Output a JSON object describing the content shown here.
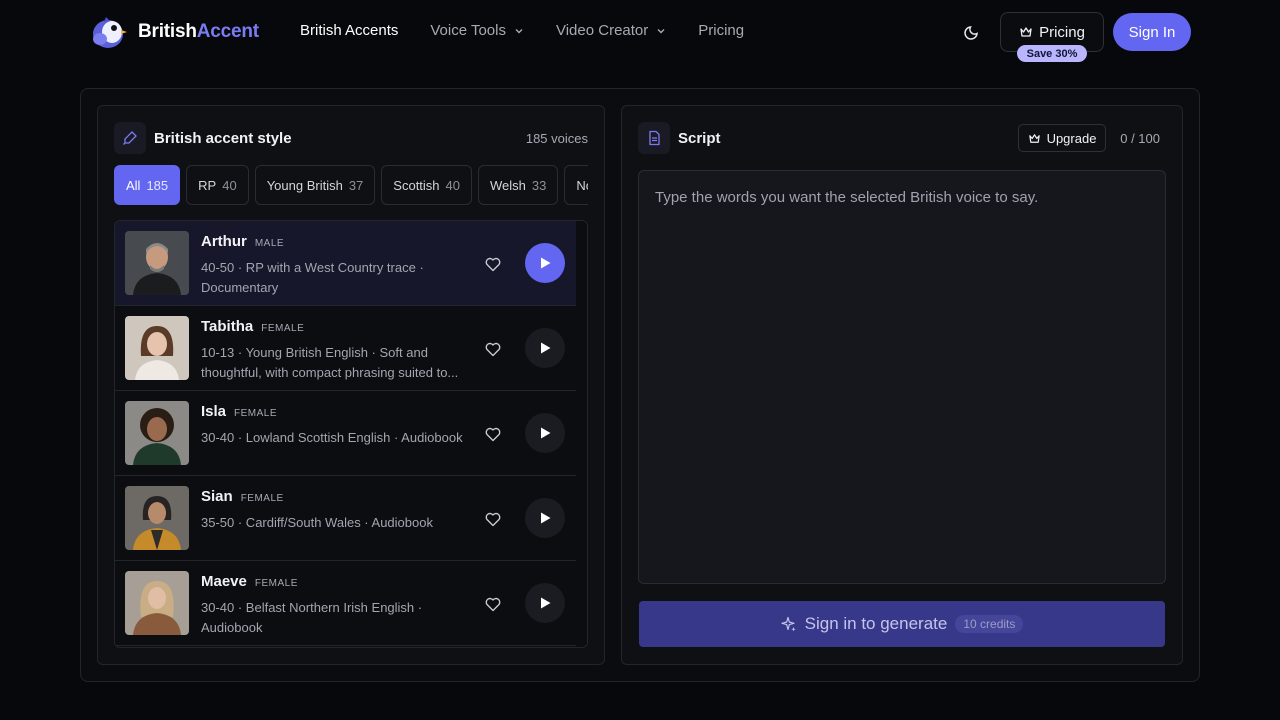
{
  "nav": {
    "brand_part1": "British",
    "brand_part2": "Accent",
    "links": [
      {
        "label": "British Accents"
      },
      {
        "label": "Voice Tools"
      },
      {
        "label": "Video Creator"
      },
      {
        "label": "Pricing"
      }
    ],
    "pricing_button": "Pricing",
    "save_badge": "Save 30%",
    "sign_in": "Sign In"
  },
  "voices_panel": {
    "title": "British accent style",
    "count": "185 voices",
    "filters": [
      {
        "label": "All",
        "count": "185"
      },
      {
        "label": "RP",
        "count": "40"
      },
      {
        "label": "Young British",
        "count": "37"
      },
      {
        "label": "Scottish",
        "count": "40"
      },
      {
        "label": "Welsh",
        "count": "33"
      },
      {
        "label": "Nor",
        "count": ""
      }
    ],
    "voices": [
      {
        "name": "Arthur",
        "gender": "MALE",
        "description": "40-50 · RP with a West Country trace · Documentary"
      },
      {
        "name": "Tabitha",
        "gender": "FEMALE",
        "description": "10-13 · Young British English · Soft and thoughtful, with compact phrasing suited to..."
      },
      {
        "name": "Isla",
        "gender": "FEMALE",
        "description": "30-40 · Lowland Scottish English · Audiobook"
      },
      {
        "name": "Sian",
        "gender": "FEMALE",
        "description": "35-50 · Cardiff/South Wales · Audiobook"
      },
      {
        "name": "Maeve",
        "gender": "FEMALE",
        "description": "30-40 · Belfast Northern Irish English · Audiobook"
      }
    ]
  },
  "script_panel": {
    "title": "Script",
    "upgrade_button": "Upgrade",
    "char_count": "0 / 100",
    "placeholder": "Type the words you want the selected British voice to say.",
    "generate_button": "Sign in to generate",
    "credits": "10 credits"
  },
  "colors": {
    "accent": "#6366f1",
    "background": "#07080b",
    "panel": "#0f1014",
    "badge": "#b9b6ff"
  },
  "icons": [
    "bird-logo-icon",
    "chevron-down-icon",
    "moon-icon",
    "crown-icon",
    "microphone-icon",
    "document-icon",
    "heart-icon",
    "play-icon",
    "sparkle-icon"
  ]
}
